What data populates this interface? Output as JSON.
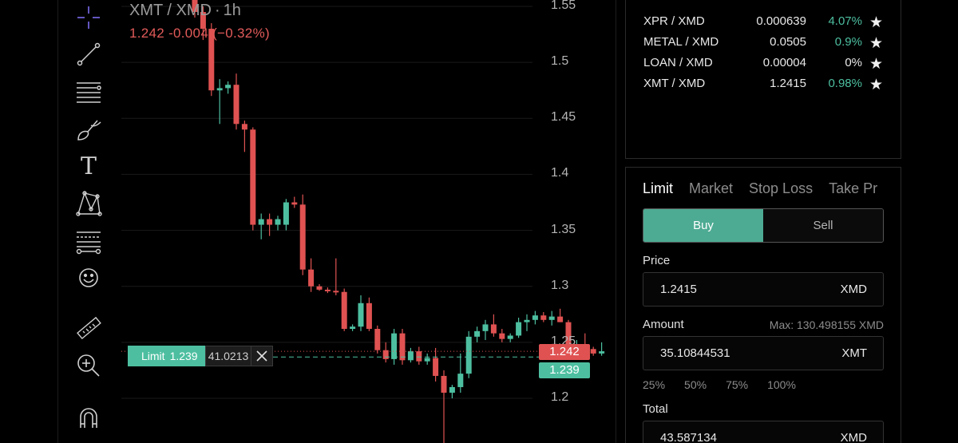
{
  "toolbar": {
    "tools": [
      {
        "name": "crosshair-icon"
      },
      {
        "name": "trend-line-icon"
      },
      {
        "name": "horizontal-lines-icon"
      },
      {
        "name": "brush-icon"
      },
      {
        "name": "text-tool-icon",
        "glyph": "T"
      },
      {
        "name": "pattern-icon"
      },
      {
        "name": "fib-levels-icon"
      },
      {
        "name": "emoji-icon"
      },
      {
        "name": "ruler-icon"
      },
      {
        "name": "zoom-in-icon"
      },
      {
        "name": "magnet-icon"
      }
    ]
  },
  "chart": {
    "symbol": "XMT / XMD",
    "separator": "·",
    "interval": "1h",
    "last_change": "1.242  -0.004 (−0.32%)",
    "y_ticks": [
      "1.55",
      "1.5",
      "1.45",
      "1.4",
      "1.35",
      "1.3",
      "1.25",
      "1.2"
    ],
    "last_price_tag": "1.242",
    "limit_price_tag": "1.239",
    "order_line": {
      "type": "Limit",
      "price": "1.239",
      "amount": "41.0213"
    },
    "colors": {
      "up": "#4dbfa0",
      "down": "#e05252"
    }
  },
  "chart_data": {
    "type": "candlestick",
    "ylim": [
      1.18,
      1.56
    ],
    "y_ticks": [
      1.55,
      1.5,
      1.45,
      1.4,
      1.35,
      1.3,
      1.25,
      1.2
    ],
    "candles": [
      {
        "o": 1.56,
        "h": 1.56,
        "l": 1.54,
        "c": 1.545
      },
      {
        "o": 1.545,
        "h": 1.55,
        "l": 1.52,
        "c": 1.53
      },
      {
        "o": 1.53,
        "h": 1.535,
        "l": 1.47,
        "c": 1.475
      },
      {
        "o": 1.475,
        "h": 1.485,
        "l": 1.445,
        "c": 1.477
      },
      {
        "o": 1.477,
        "h": 1.483,
        "l": 1.472,
        "c": 1.48
      },
      {
        "o": 1.48,
        "h": 1.49,
        "l": 1.44,
        "c": 1.445
      },
      {
        "o": 1.445,
        "h": 1.448,
        "l": 1.42,
        "c": 1.44
      },
      {
        "o": 1.44,
        "h": 1.442,
        "l": 1.35,
        "c": 1.355
      },
      {
        "o": 1.355,
        "h": 1.365,
        "l": 1.342,
        "c": 1.36
      },
      {
        "o": 1.36,
        "h": 1.365,
        "l": 1.345,
        "c": 1.355
      },
      {
        "o": 1.355,
        "h": 1.363,
        "l": 1.35,
        "c": 1.36
      },
      {
        "o": 1.355,
        "h": 1.378,
        "l": 1.35,
        "c": 1.375
      },
      {
        "o": 1.375,
        "h": 1.38,
        "l": 1.37,
        "c": 1.373
      },
      {
        "o": 1.373,
        "h": 1.382,
        "l": 1.31,
        "c": 1.315
      },
      {
        "o": 1.315,
        "h": 1.325,
        "l": 1.295,
        "c": 1.3
      },
      {
        "o": 1.3,
        "h": 1.302,
        "l": 1.296,
        "c": 1.297
      },
      {
        "o": 1.297,
        "h": 1.299,
        "l": 1.294,
        "c": 1.296
      },
      {
        "o": 1.296,
        "h": 1.325,
        "l": 1.292,
        "c": 1.295
      },
      {
        "o": 1.295,
        "h": 1.298,
        "l": 1.26,
        "c": 1.262
      },
      {
        "o": 1.262,
        "h": 1.266,
        "l": 1.26,
        "c": 1.264
      },
      {
        "o": 1.264,
        "h": 1.292,
        "l": 1.26,
        "c": 1.285
      },
      {
        "o": 1.285,
        "h": 1.29,
        "l": 1.26,
        "c": 1.262
      },
      {
        "o": 1.262,
        "h": 1.265,
        "l": 1.24,
        "c": 1.243
      },
      {
        "o": 1.243,
        "h": 1.25,
        "l": 1.232,
        "c": 1.235
      },
      {
        "o": 1.235,
        "h": 1.262,
        "l": 1.23,
        "c": 1.258
      },
      {
        "o": 1.258,
        "h": 1.262,
        "l": 1.23,
        "c": 1.234
      },
      {
        "o": 1.234,
        "h": 1.245,
        "l": 1.232,
        "c": 1.242
      },
      {
        "o": 1.242,
        "h": 1.246,
        "l": 1.23,
        "c": 1.233
      },
      {
        "o": 1.233,
        "h": 1.24,
        "l": 1.23,
        "c": 1.236
      },
      {
        "o": 1.236,
        "h": 1.245,
        "l": 1.215,
        "c": 1.22
      },
      {
        "o": 1.22,
        "h": 1.225,
        "l": 1.16,
        "c": 1.205
      },
      {
        "o": 1.205,
        "h": 1.212,
        "l": 1.2,
        "c": 1.21
      },
      {
        "o": 1.21,
        "h": 1.24,
        "l": 1.205,
        "c": 1.222
      },
      {
        "o": 1.222,
        "h": 1.26,
        "l": 1.218,
        "c": 1.255
      },
      {
        "o": 1.255,
        "h": 1.264,
        "l": 1.25,
        "c": 1.26
      },
      {
        "o": 1.26,
        "h": 1.27,
        "l": 1.252,
        "c": 1.266
      },
      {
        "o": 1.266,
        "h": 1.275,
        "l": 1.255,
        "c": 1.258
      },
      {
        "o": 1.258,
        "h": 1.262,
        "l": 1.25,
        "c": 1.253
      },
      {
        "o": 1.253,
        "h": 1.258,
        "l": 1.25,
        "c": 1.256
      },
      {
        "o": 1.256,
        "h": 1.272,
        "l": 1.254,
        "c": 1.268
      },
      {
        "o": 1.268,
        "h": 1.275,
        "l": 1.26,
        "c": 1.27
      },
      {
        "o": 1.27,
        "h": 1.278,
        "l": 1.266,
        "c": 1.274
      },
      {
        "o": 1.274,
        "h": 1.277,
        "l": 1.268,
        "c": 1.27
      },
      {
        "o": 1.27,
        "h": 1.278,
        "l": 1.265,
        "c": 1.273
      },
      {
        "o": 1.273,
        "h": 1.28,
        "l": 1.268,
        "c": 1.268
      },
      {
        "o": 1.268,
        "h": 1.27,
        "l": 1.236,
        "c": 1.24
      },
      {
        "o": 1.24,
        "h": 1.252,
        "l": 1.235,
        "c": 1.246
      },
      {
        "o": 1.246,
        "h": 1.258,
        "l": 1.24,
        "c": 1.244
      },
      {
        "o": 1.244,
        "h": 1.246,
        "l": 1.238,
        "c": 1.24
      },
      {
        "o": 1.24,
        "h": 1.25,
        "l": 1.238,
        "c": 1.242
      }
    ]
  },
  "markets": [
    {
      "pair": "XPR / XMD",
      "price": "0.000639",
      "change": "4.07%",
      "positive": true
    },
    {
      "pair": "METAL / XMD",
      "price": "0.0505",
      "change": "0.9%",
      "positive": true
    },
    {
      "pair": "LOAN / XMD",
      "price": "0.00004",
      "change": "0%",
      "positive": false
    },
    {
      "pair": "XMT / XMD",
      "price": "1.2415",
      "change": "0.98%",
      "positive": true
    }
  ],
  "order": {
    "tabs": [
      "Limit",
      "Market",
      "Stop Loss",
      "Take Pr"
    ],
    "buy_label": "Buy",
    "sell_label": "Sell",
    "price_label": "Price",
    "price_value": "1.2415",
    "price_unit": "XMD",
    "amount_label": "Amount",
    "max_label": "Max: 130.498155 XMD",
    "amount_value": "35.10844531",
    "amount_unit": "XMT",
    "percents": [
      "25%",
      "50%",
      "75%",
      "100%"
    ],
    "total_label": "Total",
    "total_value": "43.587134",
    "total_unit": "XMD"
  }
}
